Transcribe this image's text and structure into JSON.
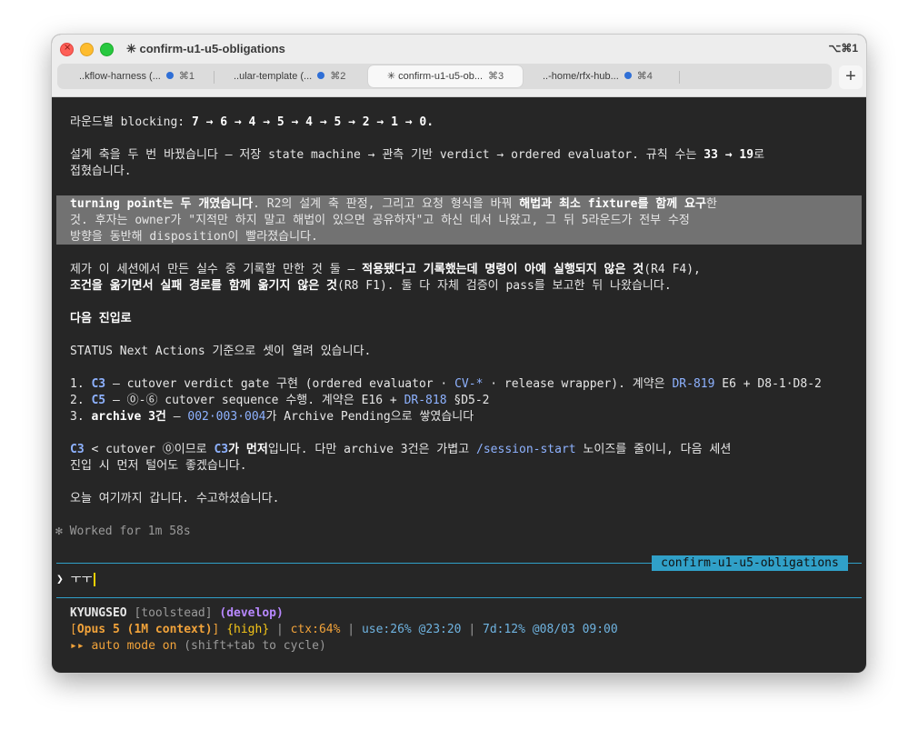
{
  "window": {
    "title": "✳ confirm-u1-u5-obligations",
    "shortcut": "⌥⌘1",
    "close_glyph": "×"
  },
  "tabs": [
    {
      "label": "..kflow-harness (...",
      "kbd": "⌘1"
    },
    {
      "label": "..ular-template (...",
      "kbd": "⌘2"
    },
    {
      "label": "✳ confirm-u1-u5-ob...",
      "kbd": "⌘3"
    },
    {
      "label": "..-home/rfx-hub...",
      "kbd": "⌘4"
    }
  ],
  "new_tab": "+",
  "conversation": {
    "l1_a": "라운드별 blocking: ",
    "l1_b": "7 → 6 → 4 → 5 → 4 → 5 → 2 → 1 → 0.",
    "l2_a": "설계 축을 두 번 바꿨습니다 — 저장 state machine → 관측 기반 verdict → ordered evaluator. 규칙 수는 ",
    "l2_b": "33 → 19",
    "l2_c": "로",
    "l3": "접혔습니다.",
    "h1_a": "turning point는 두 개였습니다",
    "h1_b": ". R2의 설계 축 판정, 그리고 요청 형식을 바꿔 ",
    "h1_c": "해법과 최소 fixture를 함께 요구",
    "h1_d": "한",
    "h2": "것. 후자는 owner가 \"지적만 하지 말고 해법이 있으면 공유하자\"고 하신 데서 나왔고, 그 뒤 5라운드가 전부 수정",
    "h3": "방향을 동반해 disposition이 빨라졌습니다.",
    "m1_a": "제가 이 세션에서 만든 실수 중 기록할 만한 것 둘 — ",
    "m1_b": "적용됐다고 기록했는데 명령이 아예 실행되지 않은 것",
    "m1_c": "(R4 F4),",
    "m2_a": "조건을 옮기면서 실패 경로를 함께 옮기지 않은 것",
    "m2_b": "(R8 F1). 둘 다 자체 검증이 pass를 보고한 뒤 나왔습니다.",
    "next_heading": "다음 진입로",
    "status_line": "STATUS Next Actions 기준으로 셋이 열려 있습니다.",
    "i1_n": "1. ",
    "i1_id": "C3",
    "i1_a": " — cutover verdict gate 구현 (ordered evaluator · ",
    "i1_b": "CV-*",
    "i1_c": " · release wrapper). 계약은 ",
    "i1_d": "DR-819",
    "i1_e": " E6 + D8-1·D8-2",
    "i2_n": "2. ",
    "i2_id": "C5",
    "i2_a": " — ⓪-⑥ cutover sequence 수행. 계약은 E16 + ",
    "i2_b": "DR-818",
    "i2_c": " §D5-2",
    "i3_n": "3. ",
    "i3_id": "archive 3건",
    "i3_a": " — ",
    "i3_b": "002·003·004",
    "i3_c": "가 Archive Pending으로 쌓였습니다",
    "c1_a": "C3",
    "c1_b": " < cutover ⓪이므로 ",
    "c1_c": "C3",
    "c1_d": "가 먼저",
    "c1_e": "입니다. 다만 archive 3건은 가볍고 ",
    "c1_f": "/session-start",
    "c1_g": " 노이즈를 줄이니, 다음 세션",
    "c2": "진입 시 먼저 털어도 좋겠습니다.",
    "bye": "오늘 여기까지 갑니다. 수고하셨습니다.",
    "worked": "✻ Worked for 1m 58s"
  },
  "session_badge": "confirm-u1-u5-obligations",
  "prompt": {
    "symbol": "❯",
    "input": "ㅜㅜ"
  },
  "statusline": {
    "user": "KYUNGSEO",
    "repo": " [toolstead] ",
    "branch": "(develop)",
    "model_open": "[",
    "model": "Opus 5 (1M context)",
    "model_close": "]",
    "effort": " {high}",
    "sep1": " | ",
    "ctx": "ctx:64%",
    "sep2": " | ",
    "use": "use:26% @23:20",
    "sep3": " | ",
    "week": "7d:12% @08/03 09:00",
    "mode_arrows": "▸▸ ",
    "mode": "auto mode on",
    "mode_hint": " (shift+tab to cycle)"
  },
  "colors": {
    "accent_cyan": "#30a0c8",
    "link_blue": "#8eb2ff",
    "orange": "#f2a33a",
    "highlight_bg": "#727272"
  }
}
